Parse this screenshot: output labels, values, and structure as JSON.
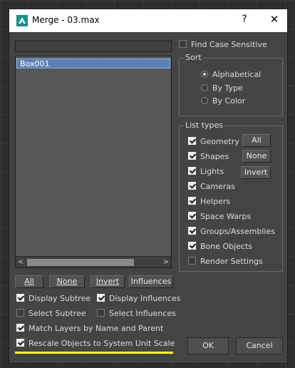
{
  "window": {
    "title": "Merge - 03.max",
    "help_glyph": "?",
    "close_glyph": "✕"
  },
  "object_list": {
    "items": [
      "Box001"
    ]
  },
  "list_buttons": {
    "all": "All",
    "none": "None",
    "invert": "Invert",
    "influences": "Influences"
  },
  "options": {
    "display_subtree": {
      "label": "Display Subtree",
      "checked": true
    },
    "display_influences": {
      "label": "Display Influences",
      "checked": true
    },
    "select_subtree": {
      "label": "Select Subtree",
      "checked": false
    },
    "select_influences": {
      "label": "Select Influences",
      "checked": false
    },
    "match_layers": {
      "label": "Match Layers by Name and Parent",
      "checked": true
    },
    "rescale_objects": {
      "label": "Rescale Objects to System Unit Scale",
      "checked": true
    }
  },
  "find_case_sensitive": {
    "label": "Find Case Sensitive",
    "checked": false
  },
  "sort": {
    "title": "Sort",
    "options": [
      "Alphabetical",
      "By Type",
      "By Color"
    ],
    "selected": "Alphabetical"
  },
  "list_types": {
    "title": "List types",
    "items": [
      {
        "label": "Geometry",
        "checked": true
      },
      {
        "label": "Shapes",
        "checked": true
      },
      {
        "label": "Lights",
        "checked": true
      },
      {
        "label": "Cameras",
        "checked": true
      },
      {
        "label": "Helpers",
        "checked": true
      },
      {
        "label": "Space Warps",
        "checked": true
      },
      {
        "label": "Groups/Assemblies",
        "checked": true
      },
      {
        "label": "Bone Objects",
        "checked": true
      },
      {
        "label": "Render Settings",
        "checked": false
      }
    ],
    "buttons": {
      "all": "All",
      "none": "None",
      "invert": "Invert"
    }
  },
  "footer": {
    "ok": "OK",
    "cancel": "Cancel"
  },
  "colors": {
    "dialog_bg": "#444444",
    "selection": "#5b7fb7",
    "highlight": "#ffff33"
  }
}
